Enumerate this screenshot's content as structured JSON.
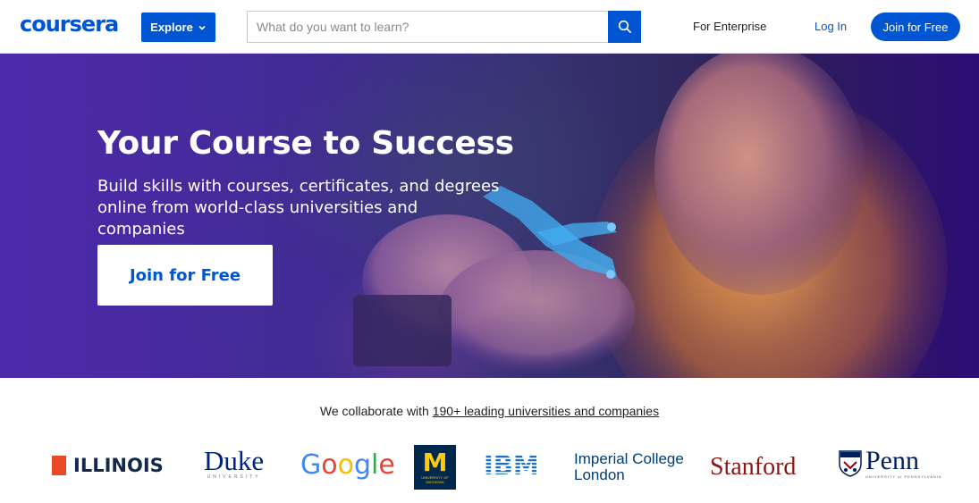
{
  "header": {
    "logo": "coursera",
    "explore_label": "Explore",
    "search_placeholder": "What do you want to learn?",
    "for_enterprise": "For Enterprise",
    "login": "Log In",
    "join": "Join for Free"
  },
  "hero": {
    "title": "Your Course to Success",
    "subtitle": "Build skills with courses, certificates, and degrees online from world-class universities and companies",
    "cta": "Join for Free"
  },
  "partners": {
    "prefix": "We collaborate with ",
    "link": "190+ leading universities and companies",
    "logos": {
      "illinois": "ILLINOIS",
      "duke": "Duke",
      "duke_sub": "UNIVERSITY",
      "google": [
        "G",
        "o",
        "o",
        "g",
        "l",
        "e"
      ],
      "michigan": "M",
      "michigan_sub": "UNIVERSITY OF MICHIGAN",
      "ibm": "IBM",
      "imperial_line1": "Imperial College",
      "imperial_line2": "London",
      "stanford": "Stanford",
      "penn": "Penn",
      "penn_sub": "UNIVERSITY of PENNSYLVANIA"
    }
  },
  "colors": {
    "brand_blue": "#0056d2",
    "google": [
      "#4285f4",
      "#ea4335",
      "#fbbc05",
      "#4285f4",
      "#34a853",
      "#ea4335"
    ],
    "illinois_orange": "#e84a27",
    "michigan_maize": "#ffcb05",
    "stanford_red": "#8c1515"
  },
  "icons": {
    "explore": "chevron-down-icon",
    "search": "search-icon"
  }
}
